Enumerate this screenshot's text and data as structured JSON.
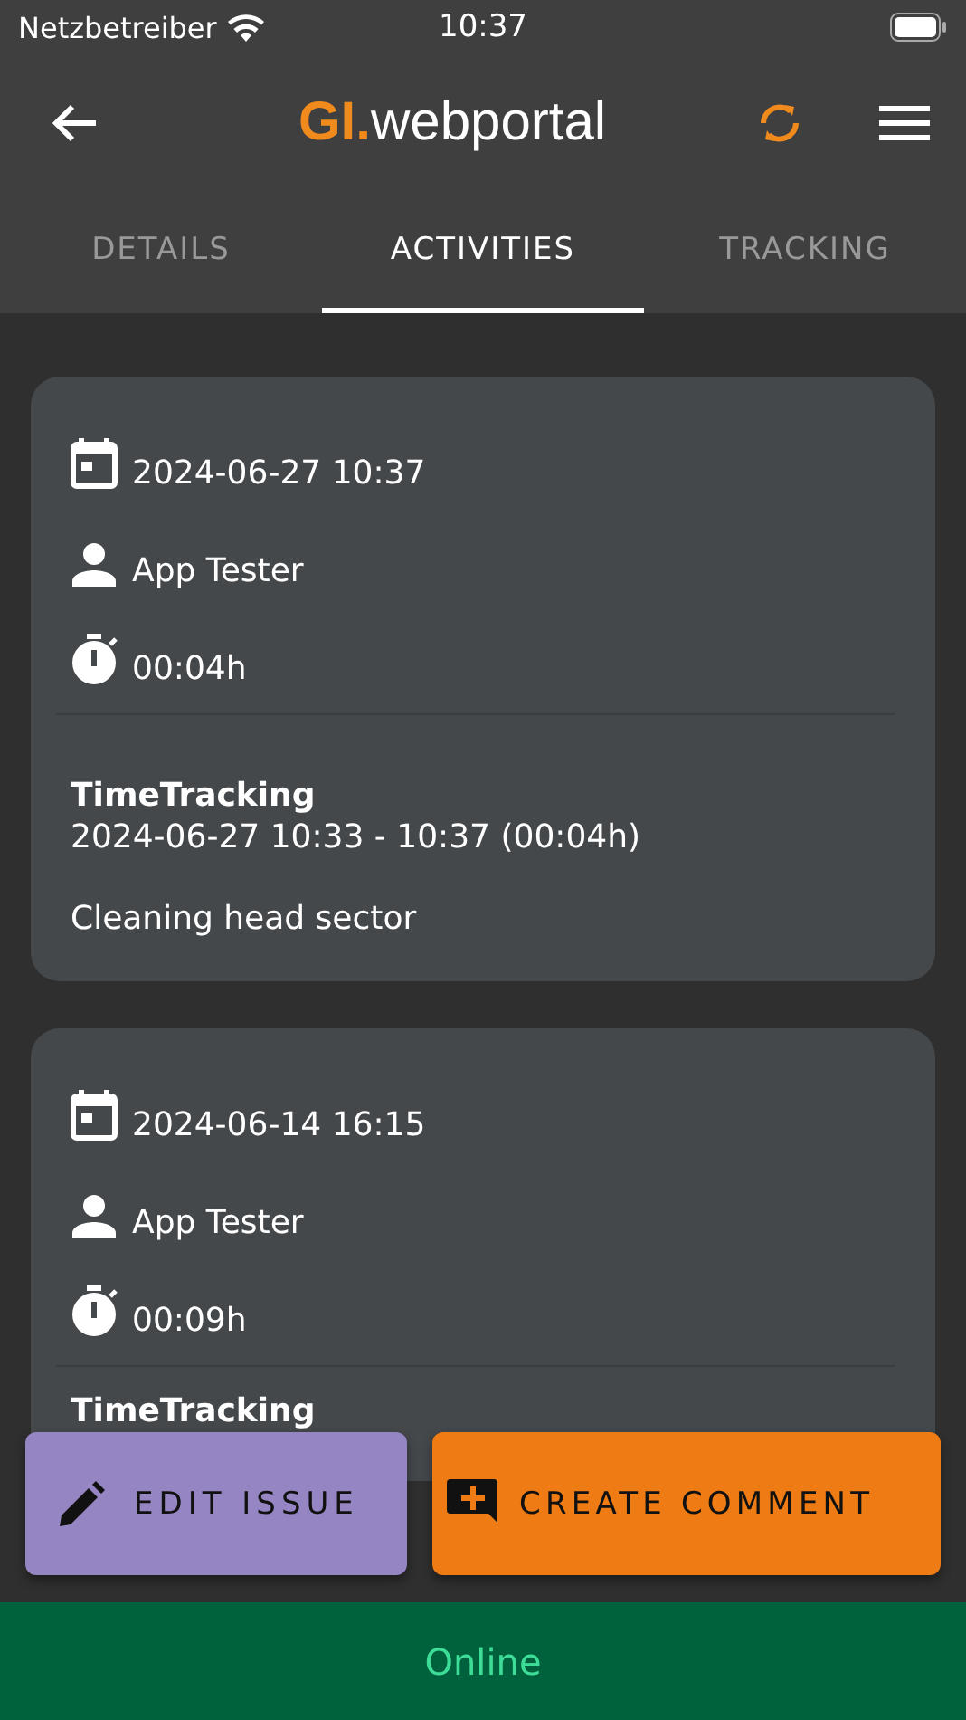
{
  "status_bar": {
    "carrier": "Netzbetreiber",
    "time": "10:37"
  },
  "header": {
    "logo_accent": "GI.",
    "logo_text": "webportal"
  },
  "tabs": [
    {
      "label": "DETAILS",
      "selected": false
    },
    {
      "label": "ACTIVITIES",
      "selected": true
    },
    {
      "label": "TRACKING",
      "selected": false
    }
  ],
  "activities": [
    {
      "date": "2024-06-27 10:37",
      "user": "App Tester",
      "duration": "00:04h",
      "title": "TimeTracking",
      "range": "2024-06-27 10:33 - 10:37 (00:04h)",
      "description": "Cleaning head sector"
    },
    {
      "date": "2024-06-14 16:15",
      "user": "App Tester",
      "duration": "00:09h",
      "title": "TimeTracking"
    }
  ],
  "actions": [
    {
      "kind": "edit",
      "label": "EDIT ISSUE"
    },
    {
      "kind": "comment",
      "label": "CREATE COMMENT"
    }
  ],
  "connection": {
    "label": "Online",
    "online": true
  }
}
